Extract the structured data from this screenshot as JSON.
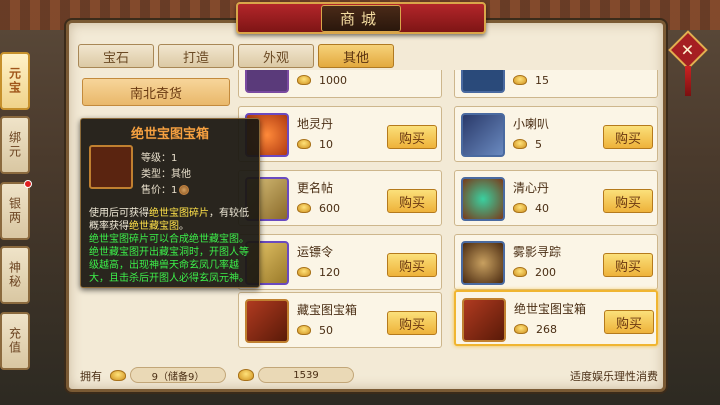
{
  "title": "商城",
  "close_icon": "✕",
  "sidebar": {
    "items": [
      {
        "label": "元宝",
        "active": true
      },
      {
        "label": "绑元",
        "active": false
      },
      {
        "label": "银两",
        "active": false,
        "badge": true
      },
      {
        "label": "神秘",
        "active": false
      },
      {
        "label": "充值",
        "active": false
      }
    ]
  },
  "tabs": [
    {
      "label": "宝石"
    },
    {
      "label": "打造"
    },
    {
      "label": "外观"
    },
    {
      "label": "其他"
    }
  ],
  "active_tab": "其他",
  "category": "南北奇货",
  "items": [
    {
      "name": "",
      "price": "1000",
      "buy": "",
      "partial": true
    },
    {
      "name": "",
      "price": "15",
      "buy": "",
      "partial": true
    },
    {
      "name": "地灵丹",
      "price": "10",
      "buy": "购买"
    },
    {
      "name": "小喇叭",
      "price": "5",
      "buy": "购买"
    },
    {
      "name": "更名帖",
      "price": "600",
      "buy": "购买"
    },
    {
      "name": "清心丹",
      "price": "40",
      "buy": "购买"
    },
    {
      "name": "运镖令",
      "price": "120",
      "buy": "购买"
    },
    {
      "name": "雾影寻踪",
      "price": "200",
      "buy": "购买"
    },
    {
      "name": "藏宝图宝箱",
      "price": "50",
      "buy": "购买"
    },
    {
      "name": "绝世宝图宝箱",
      "price": "268",
      "buy": "购买",
      "selected": true
    }
  ],
  "tooltip": {
    "title": "绝世宝图宝箱",
    "level": "等级：1",
    "type": "类型：其他",
    "price": "售价：1",
    "desc1_a": "使用后可获得",
    "desc1_b": "绝世宝图碎片",
    "desc1_c": "，有较低概率获得",
    "desc1_d": "绝世藏宝图",
    "desc1_e": "。",
    "desc2": "绝世宝图碎片可以合成绝世藏宝图。绝世藏宝图开出藏宝洞时，开图人等级越高，出现神兽天命玄凤几率越大，且击杀后开图人必得玄凤元神。"
  },
  "bottom": {
    "owned_label": "拥有",
    "gold_amount": "9（储备9）",
    "bound_amount": "1539",
    "note": "适度娱乐理性消费"
  },
  "colors": {
    "accent": "#e3a93e",
    "title_red": "#b3262a",
    "tooltip_title": "#f5a040",
    "tooltip_yellow": "#ffe24a",
    "tooltip_green": "#3cf04a"
  }
}
